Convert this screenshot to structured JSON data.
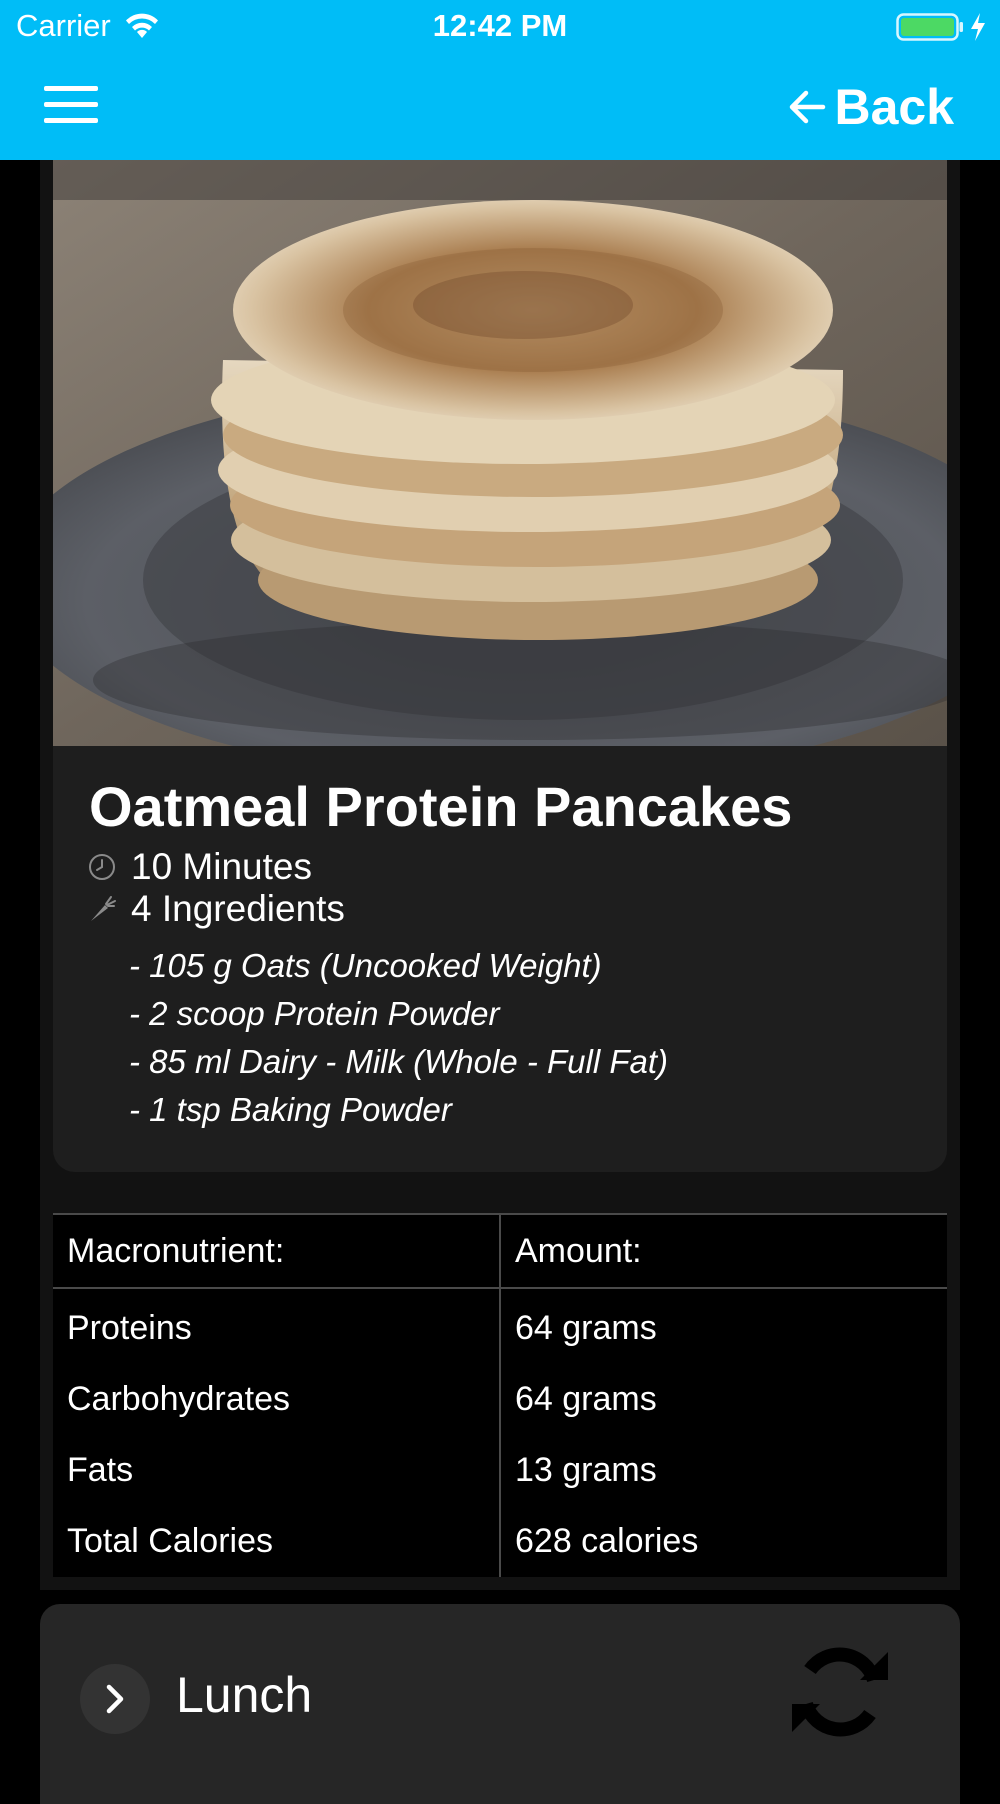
{
  "status_bar": {
    "carrier": "Carrier",
    "time": "12:42 PM",
    "battery_color": "#4cd964"
  },
  "nav": {
    "menu_icon": "hamburger-icon",
    "back_label": "Back",
    "bar_color": "#00bdf7"
  },
  "recipe": {
    "image_subject": "stack of oatmeal protein pancakes on a grey plate",
    "title": "Oatmeal Protein Pancakes",
    "time_label": "10 Minutes",
    "time_icon": "clock-icon",
    "ingredient_count_label": "4 Ingredients",
    "ingredient_icon": "carrot-icon",
    "ingredients": [
      "- 105 g Oats (Uncooked Weight)",
      "- 2 scoop Protein Powder",
      "- 85 ml Dairy - Milk (Whole - Full Fat)",
      "- 1 tsp Baking Powder"
    ]
  },
  "macros": {
    "headers": [
      "Macronutrient:",
      "Amount:"
    ],
    "rows": [
      [
        "Proteins",
        "64 grams"
      ],
      [
        "Carbohydrates",
        "64 grams"
      ],
      [
        "Fats",
        "13 grams"
      ],
      [
        "Total Calories",
        "628 calories"
      ]
    ]
  },
  "next_meal": {
    "title": "Lunch",
    "expand_icon": "chevron-right-icon",
    "action_icon": "refresh-icon"
  }
}
